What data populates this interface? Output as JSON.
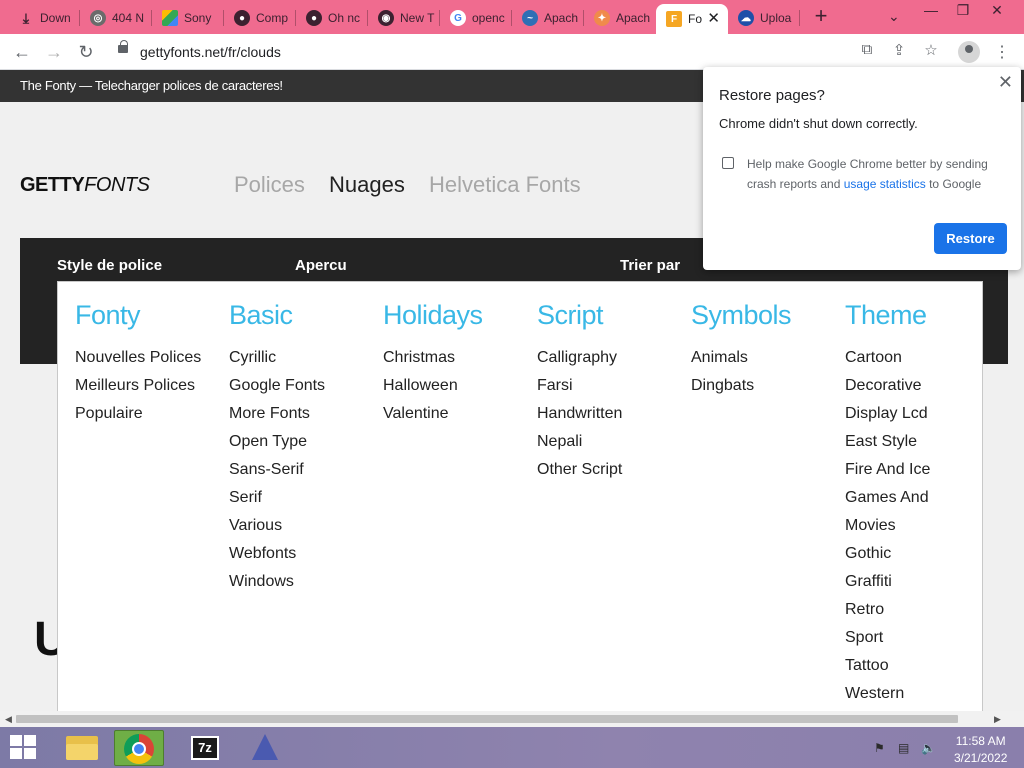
{
  "browser": {
    "tabs": [
      {
        "label": "Down",
        "favicon": "download-icon"
      },
      {
        "label": "404 N",
        "favicon": "globe-icon"
      },
      {
        "label": "Sony",
        "favicon": "drive-icon"
      },
      {
        "label": "Comp",
        "favicon": "github-icon"
      },
      {
        "label": "Oh nc",
        "favicon": "github-icon"
      },
      {
        "label": "New T",
        "favicon": "chrome-icon"
      },
      {
        "label": "openc",
        "favicon": "google-icon"
      },
      {
        "label": "Apach",
        "favicon": "apache-icon"
      },
      {
        "label": "Apach",
        "favicon": "apache-icon"
      },
      {
        "label": "Fo",
        "favicon": "fonty-icon",
        "active": true
      },
      {
        "label": "Uploa",
        "favicon": "cloud-upload-icon"
      }
    ],
    "url": "gettyfonts.net/fr/clouds",
    "colors": {
      "tabstrip": "#f06b8f",
      "accent": "#1a73e8"
    }
  },
  "page": {
    "topbar_text": "The Fonty — Telecharger polices de caracteres!",
    "logo": {
      "bold": "GETTY",
      "italic": "FONTS"
    },
    "nav": [
      {
        "label": "Polices"
      },
      {
        "label": "Nuages",
        "active": true
      },
      {
        "label": "Helvetica Fonts"
      }
    ],
    "column_headers": [
      "Style de police",
      "Apercu",
      "Trier par"
    ],
    "partial_heading": "U",
    "menu": [
      {
        "title": "Fonty",
        "items": [
          "Nouvelles Polices",
          "Meilleurs Polices",
          "Populaire"
        ]
      },
      {
        "title": "Basic",
        "items": [
          "Cyrillic",
          "Google Fonts",
          "More Fonts",
          "Open Type",
          "Sans-Serif",
          "Serif",
          "Various",
          "Webfonts",
          "Windows"
        ]
      },
      {
        "title": "Holidays",
        "items": [
          "Christmas",
          "Halloween",
          "Valentine"
        ]
      },
      {
        "title": "Script",
        "items": [
          "Calligraphy",
          "Farsi",
          "Handwritten",
          "Nepali",
          "Other Script"
        ]
      },
      {
        "title": "Symbols",
        "items": [
          "Animals",
          "Dingbats"
        ]
      },
      {
        "title": "Theme",
        "items": [
          "Cartoon",
          "Decorative",
          "Display Lcd",
          "East Style",
          "Fire And Ice",
          "Games And",
          "Movies",
          "Gothic",
          "Graffiti",
          "Retro",
          "Sport",
          "Tattoo",
          "Western"
        ]
      }
    ],
    "menu_title_color": "#39b8e6"
  },
  "restore_popup": {
    "title": "Restore pages?",
    "message": "Chrome didn't shut down correctly.",
    "checkbox_text_before": "Help make Google Chrome better by sending crash reports and ",
    "checkbox_link": "usage statistics",
    "checkbox_text_after": " to Google",
    "checked": false,
    "button": "Restore"
  },
  "taskbar": {
    "apps": [
      "file-explorer-icon",
      "chrome-icon",
      "7zip-icon",
      "app-icon"
    ],
    "tray_icons": [
      "flag-icon",
      "network-icon",
      "volume-muted-icon"
    ],
    "time": "11:58 AM",
    "date": "3/21/2022"
  }
}
